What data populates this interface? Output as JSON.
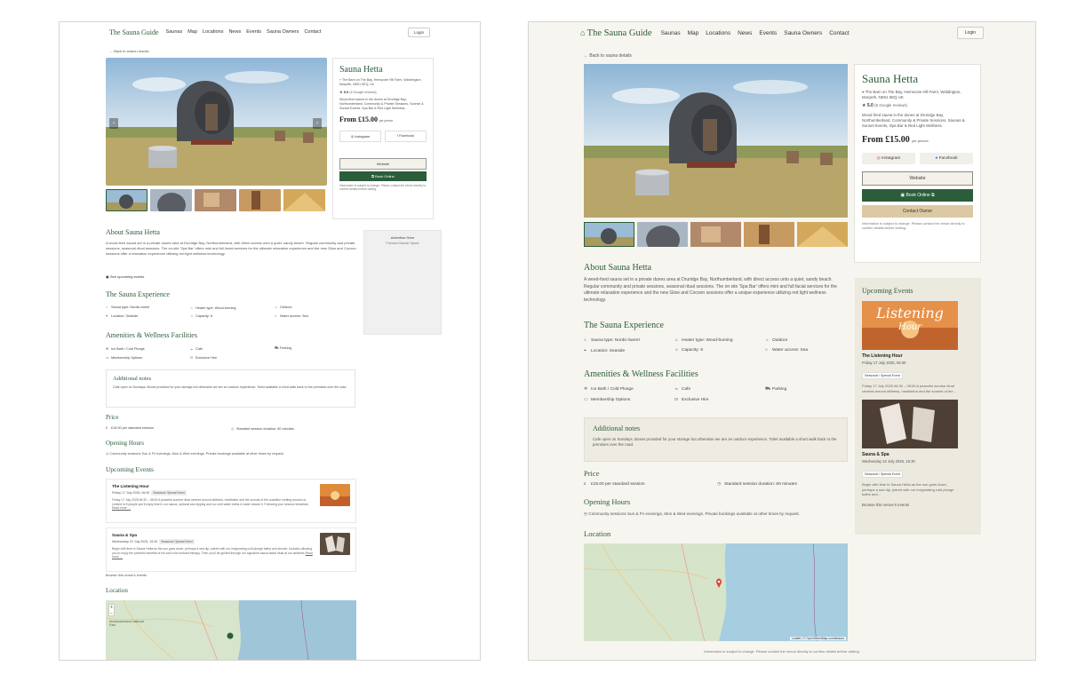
{
  "brand": "The Sauna Guide",
  "nav": [
    "Saunas",
    "Map",
    "Locations",
    "News",
    "Events",
    "Sauna Owners",
    "Contact"
  ],
  "login": "Login",
  "shotA": {
    "back": "← Back to search results",
    "sauna": {
      "name": "Sauna Hetta",
      "address": "The Barn on The Bay, Hemscote Hill Farm, Widdrington, Morpeth, NE61 5EQ, Uk",
      "rating": "5.0",
      "reviews": "(6 Google reviews)",
      "desc": "Wood-fired sauna in the dunes at Druridge Bay, Northumberland. Community & Private Sessions, Sunrise & Sunset Events, Spa Bar & Red Light Wellness.",
      "price": "From £15.00",
      "price_unit": "per person",
      "instagram": "Instagram",
      "facebook": "Facebook",
      "website": "Website",
      "book": "Book Online",
      "info": "Information is subject to change. Please contact the venue directly to confirm details before visiting."
    },
    "advertise": {
      "title": "Advertise Here",
      "sub": "Premium Banner Space"
    },
    "about": {
      "title": "About Sauna Hetta",
      "text": "A wood-fired sauna set in a private dunes area at Druridge Bay, Northumberland, with direct access onto a quiet, sandy beach. Regular community and private sessions, seasonal ritual sessions. The on-site 'Spa Bar' offers mini and full facial services for the ultimate relaxation experience and the new Glow and Cocoon sessions offer a relaxation experience utilising red light wellness technology.",
      "events_link": "See upcoming events"
    },
    "experience": {
      "title": "The Sauna Experience",
      "items": [
        "Sauna type: Nordic-barrel",
        "Heater type: Wood-burning",
        "Outdoor",
        "Location: Seaside",
        "Capacity: 8",
        "Water access: Sea"
      ]
    },
    "amenities": {
      "title": "Amenities & Wellness Facilities",
      "items": [
        "Ice Bath / Cold Plunge",
        "Cafe",
        "Parking",
        "Membership Options",
        "Exclusive Hire"
      ]
    },
    "notes": {
      "title": "Additional notes",
      "text": "Cafe open on Sundays. Boxes provided for your storage but otherwise we are an outdoor experience. Toilet available a short walk back to the premises over the road."
    },
    "price": {
      "title": "Price",
      "items": [
        "£15.00 per standard session",
        "Standard session duration: 60 minutes"
      ]
    },
    "hours": {
      "title": "Opening Hours",
      "text": "Community sessions Sun & Fri evenings, Mon & Wed evenings. Private bookings available at other times by request."
    },
    "upcoming": {
      "title": "Upcoming Events",
      "events": [
        {
          "title": "The Listening Hour",
          "date": "Friday 17 July 2025, 06:30",
          "badge": "Seasonal / Special Event",
          "text": "Friday 17 July 2025 06:30 – 08:00 A peaceful sunrise ritual centred around stillness, meditation and the sounds of the coastline melting around us. Limited to 8 people you'll enjoy time in our sauna, optional sea dipping and our cold water baths & water toward it. Following your session breakfast.",
          "read": "Read more →"
        },
        {
          "title": "Sauna & Spa",
          "date": "Wednesday 22 July 2025, 15:30",
          "badge": "Seasonal / Special Event",
          "text": "Begin with time in Sauna Hetta as the sun goes down, perhaps a sea dip, paired with our invigorating cold plunge baths and shower. Includes allowing you to enjoy the powerful benefits of hot and cold contrast therapy. Then you'll be guided through our signature sauna facial ritual at our wellness",
          "read": "Read more →"
        }
      ],
      "browse": "Browse this venue's events"
    },
    "location": {
      "title": "Location",
      "map_label": "Northumberland National Park"
    }
  },
  "shotB": {
    "back": "← Back to sauna details",
    "sauna": {
      "name": "Sauna Hetta",
      "address": "The Barn on The Bay, Hemscote Hill Farm, Widdington, Morpeth, NE61 5EQ UK",
      "rating": "5.0",
      "reviews": "(6 Google reviews)",
      "desc": "Wood fired sauna in the dunes at Druridge Bay, Northumberland. Community & Private Sessions, Saunas & Sunset Events, Spa Bar & Red Light Wellness.",
      "price": "From £15.00",
      "price_unit": "per person",
      "instagram": "Instagram",
      "facebook": "Facebook",
      "website": "Website",
      "book": "Book Online",
      "owner": "Contact Owner",
      "info": "Information is subject to change. Please contact the venue directly to confirm details before visiting."
    },
    "about": {
      "title": "About Sauna Hetta",
      "text": "A weed-foed sauna set in a private dunes area at Druridge Bay, Northumberland, with direct access unto a quiet, sandy beach. Regular community and private sessions, seasonal ritual sessions. The on site 'Spa Bar' offers mini and full facial services for the ultimate relaxation experience and the new Glow and Cocoon sessions offer a unique experience utilizing red light wellness technology."
    },
    "experience": {
      "title": "The Sauna Experience",
      "items": [
        "Sauna type: Nordic-barrel",
        "Heater type: Wood-burning",
        "Outdoor",
        "Location: Seaside",
        "Capacity: 8",
        "Water access: Sea"
      ]
    },
    "amenities": {
      "title": "Amenities & Wellness Facilities",
      "items": [
        "Ice Bath / Cold Plunge",
        "Cafe",
        "Parking",
        "Membership Options",
        "Exclusive Hire"
      ]
    },
    "notes": {
      "title": "Additional notes",
      "text": "Cafe open on Sundays. Boxes provided for your storage but otherwise we are an outdoor experience. Toilet available a short walk back to the premises over the road."
    },
    "price": {
      "title": "Price",
      "items": [
        "£15.00 per standard session",
        "Standard session duration: 60 minutes"
      ]
    },
    "hours": {
      "title": "Opening Hours",
      "text": "Community sessions Sun & Fri evenings, Mon & Wed evenings. Private bookings available at other times by request."
    },
    "location": {
      "title": "Location",
      "attribution": "Leaflet | © OpenStreetMap contributors"
    },
    "upcoming": {
      "title": "Upcoming Events",
      "poster": "Listening",
      "poster_sub": "Hour",
      "events": [
        {
          "title": "The Listening Hour",
          "date": "Friday 17 July 2025, 06:30",
          "badge": "Seasonal / Special Event",
          "text": "Friday 17 July 2025 06:30 – 08:00 A peaceful sunrise ritual centred around stillness, meditation and the sounds of the..."
        },
        {
          "title": "Sauna & Spa",
          "date": "Wednesday 22 July 2025, 15:30",
          "badge": "Seasonal / Special Event",
          "text": "Begin with time in Sauna Hetta as the sun goes down, perhaps a sea dip, paired with our invigorating cold plunge baths and..."
        }
      ],
      "browse": "Browse this venue's events"
    },
    "footer": "Information is subject to change. Please contact the venue directly to confirm details before visiting."
  }
}
